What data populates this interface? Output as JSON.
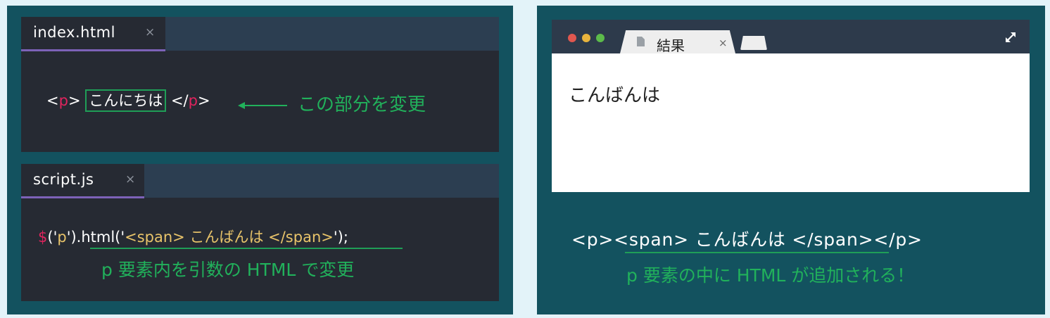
{
  "html_editor": {
    "tab_title": "index.html",
    "tab_close": "×",
    "code": {
      "open_lt": "<",
      "open_tag": "p",
      "open_gt": ">",
      "content": "こんにちは",
      "close_lt": "</",
      "close_tag": "p",
      "close_gt": ">"
    },
    "annotation": "この部分を変更"
  },
  "js_editor": {
    "tab_title": "script.js",
    "tab_close": "×",
    "code": {
      "dollar": "$",
      "p1": "('",
      "arg": "p",
      "p2": "').html('",
      "str": "<span> こんばんは </span>",
      "p3": "');"
    },
    "annotation": "p 要素内を引数の HTML で変更"
  },
  "browser": {
    "traffic_colors": [
      "#e0574f",
      "#e8b43d",
      "#5cbb4a"
    ],
    "tab_title": "結果",
    "tab_close": "×",
    "content_text": "こんばんは"
  },
  "result": {
    "code": "<p><span> こんばんは </span></p>",
    "annotation": "p 要素の中に HTML が追加される！"
  },
  "colors": {
    "background": "#e3f3f9",
    "panel": "#13525f",
    "editor_bg": "#262a33",
    "tab_bar": "#2c3e51",
    "tab_underline": "#7d62b8",
    "tag_red": "#e0245e",
    "string_yellow": "#e9c46a",
    "accent_green": "#21b15b"
  }
}
